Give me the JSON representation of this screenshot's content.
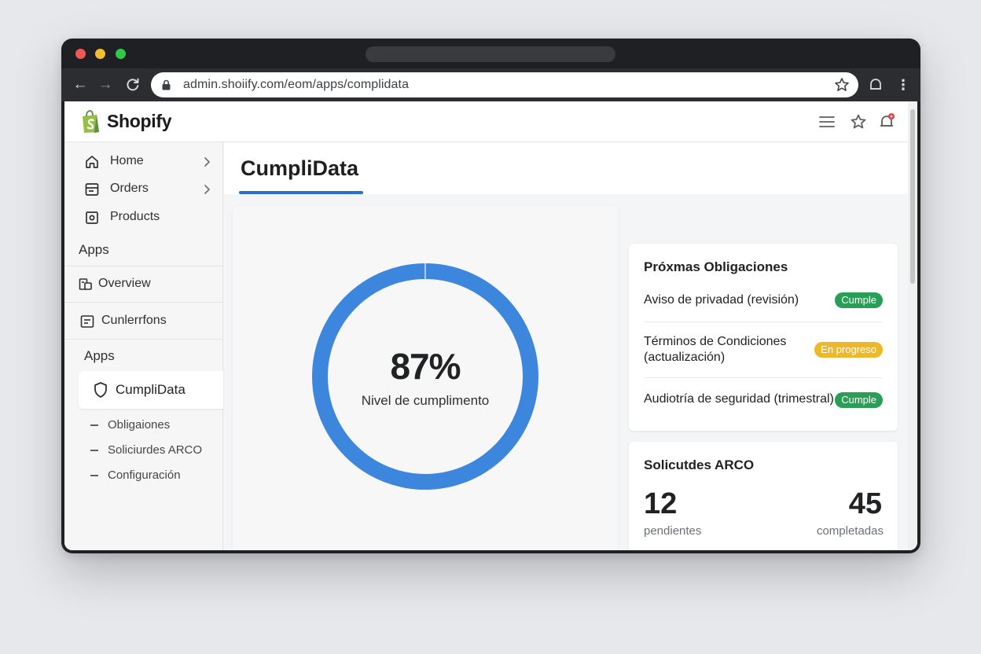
{
  "browser": {
    "url": "admin.shoiify.com/eom/apps/complidata"
  },
  "header": {
    "brand": "Shopify"
  },
  "sidebar": {
    "nav": [
      {
        "label": "Home"
      },
      {
        "label": "Orders"
      },
      {
        "label": "Products"
      }
    ],
    "section_apps_1": "Apps",
    "overview": "Overview",
    "customers": "Cunlerrfons",
    "section_apps_2": "Apps",
    "active_app": "CumpliData",
    "sub_items": [
      {
        "label": "Obligaiones"
      },
      {
        "label": "Soliciurdes ARCO"
      },
      {
        "label": "Configuración"
      }
    ]
  },
  "page": {
    "title": "CumpliData"
  },
  "compliance": {
    "value_text": "87%",
    "value": 87,
    "label": "Nivel de cumplimento"
  },
  "obligations": {
    "title": "Próxmas Obligaciones",
    "items": [
      {
        "label": "Aviso de privadad (revisión)",
        "status": "Cumple"
      },
      {
        "label_line1": "Términos de Condiciones",
        "label_line2": "(actualización)",
        "status": "En progreso"
      },
      {
        "label": "Audiotría de seguridad (trimestral)",
        "status": "Cumple"
      }
    ]
  },
  "arco": {
    "title": "Solicutdes ARCO",
    "pending_value": "12",
    "pending_label": "pendientes",
    "completed_value": "45",
    "completed_label": "completadas"
  },
  "colors": {
    "accent": "#2c6ecb",
    "gauge": "#3d86dd",
    "ok": "#2a9d56",
    "progress": "#edb928"
  }
}
